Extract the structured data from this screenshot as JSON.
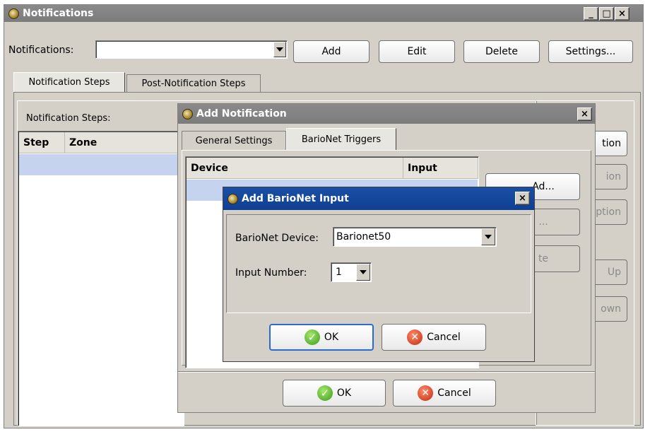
{
  "main_window": {
    "title": "Notifications",
    "notifications_label": "Notifications:",
    "notifications_value": "",
    "buttons": {
      "add": "Add",
      "edit": "Edit",
      "delete": "Delete",
      "settings": "Settings..."
    },
    "tabs": [
      {
        "label": "Notification Steps",
        "selected": true
      },
      {
        "label": "Post-Notification Steps",
        "selected": false
      }
    ],
    "steps_label": "Notification Steps:",
    "columns": [
      "Step",
      "Zone"
    ],
    "side_buttons": [
      "tion",
      "ion",
      "ption",
      "Up",
      "own"
    ]
  },
  "add_notification": {
    "title": "Add Notification",
    "tabs": [
      {
        "label": "General Settings",
        "selected": false
      },
      {
        "label": "BarioNet Triggers",
        "selected": true
      }
    ],
    "columns": [
      "Device",
      "Input"
    ],
    "side_buttons": [
      "Ad...",
      "...",
      "te"
    ],
    "ok": "OK",
    "cancel": "Cancel"
  },
  "add_barionet_input": {
    "title": "Add BarioNet Input",
    "device_label": "BarioNet Device:",
    "device_value": "Barionet50",
    "input_label": "Input Number:",
    "input_value": "1",
    "ok": "OK",
    "cancel": "Cancel"
  },
  "icons": [
    "app-icon",
    "minimize-icon",
    "maximize-icon",
    "close-icon",
    "dropdown-arrow-icon",
    "ok-check-icon",
    "cancel-x-icon"
  ]
}
